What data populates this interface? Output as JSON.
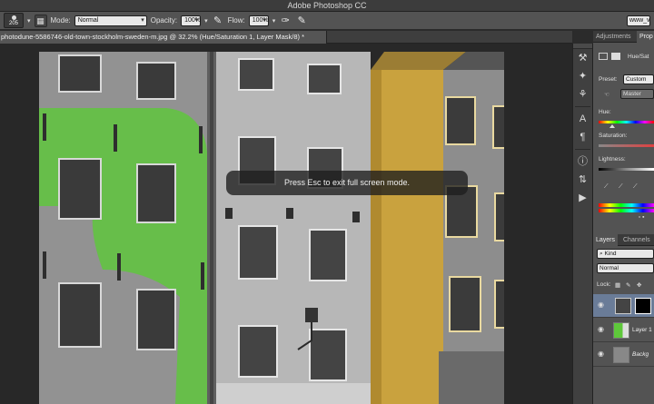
{
  "app": {
    "title": "Adobe Photoshop CC"
  },
  "options_bar": {
    "brush_size": "205",
    "mode_label": "Mode:",
    "mode_value": "Normal",
    "opacity_label": "Opacity:",
    "opacity_value": "100%",
    "flow_label": "Flow:",
    "flow_value": "100%",
    "workspace_value": "www_vi"
  },
  "document": {
    "tab_title": "photodune-5586746-old-town-stockholm-sweden-m.jpg @ 32.2% (Hue/Saturation 1, Layer Mask/8) *"
  },
  "toast": {
    "message": "Press Esc to exit full screen mode."
  },
  "properties_panel": {
    "tab_adjustments": "Adjustments",
    "tab_properties": "Prop",
    "header_label": "Hue/Sat",
    "preset_label": "Preset:",
    "preset_value": "Custom",
    "channel_value": "Master",
    "hue_label": "Hue:",
    "saturation_label": "Saturation:",
    "lightness_label": "Lightness:"
  },
  "layers_panel": {
    "tab_layers": "Layers",
    "tab_channels": "Channels",
    "filter_value": "Kind",
    "blend_mode": "Normal",
    "lock_label": "Lock:",
    "layers": [
      {
        "name": ""
      },
      {
        "name": "Layer 1"
      },
      {
        "name": "Backg"
      }
    ]
  },
  "colors": {
    "green_overlay": "#5ec83a",
    "yellow_building": "#c9a23e",
    "app_bg": "#535353"
  }
}
